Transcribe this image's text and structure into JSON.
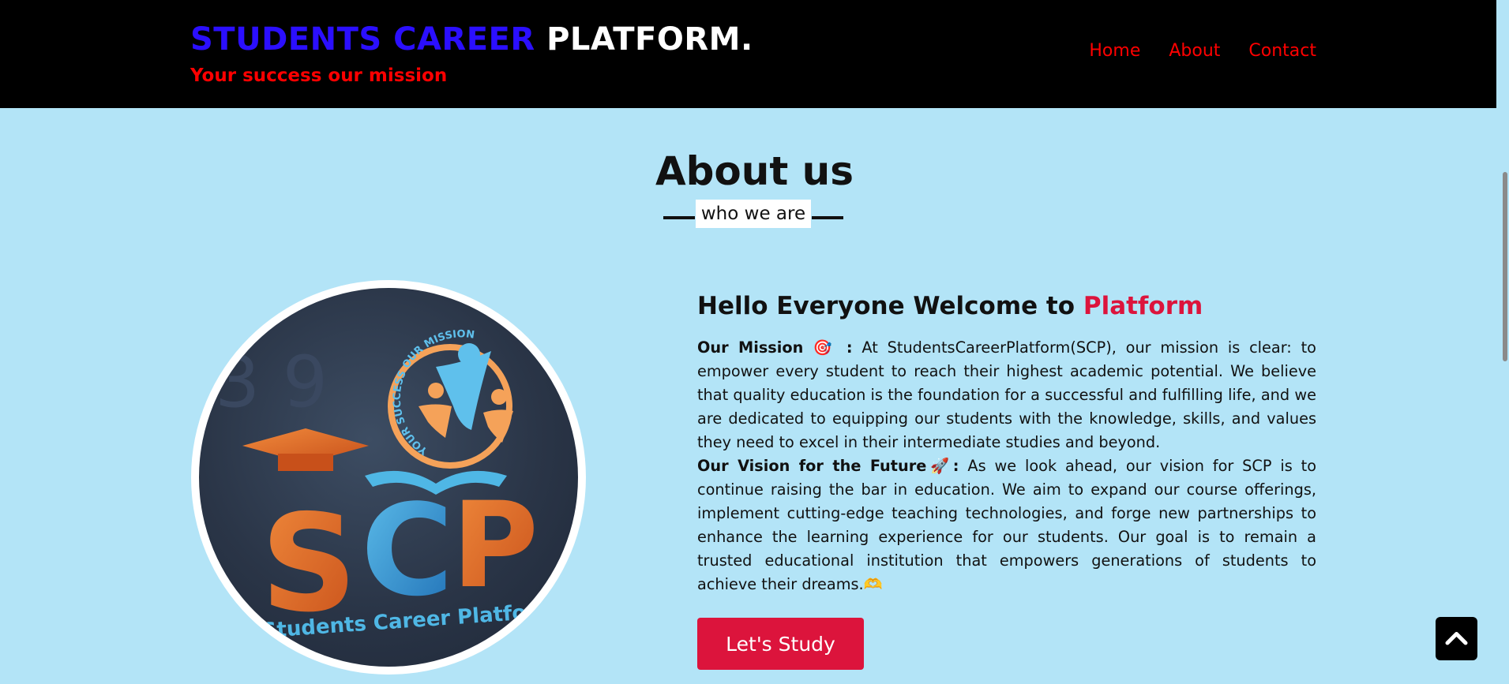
{
  "header": {
    "brand_part1": "STUDENTS CAREER",
    "brand_part2": "PLATFORM.",
    "tagline": "Your success our mission",
    "nav": [
      "Home",
      "About",
      "Contact"
    ]
  },
  "about": {
    "title": "About us",
    "subtitle": "who we are"
  },
  "logo": {
    "letters": "SCP",
    "arc_text": "YOUR SUCCESS OUR MISSION",
    "caption": "Students Career Platform"
  },
  "content": {
    "hello_prefix": "Hello Everyone Welcome to ",
    "hello_accent": "Platform",
    "mission_label": "Our Mission 🎯 :",
    "mission_text": " At StudentsCareerPlatform(SCP), our mission is clear: to empower every student to reach their highest academic potential. We believe that quality education is the foundation for a successful and fulfilling life, and we are dedicated to equipping our students with the knowledge, skills, and values they need to excel in their intermediate studies and beyond.",
    "vision_label": "Our Vision for the Future🚀:",
    "vision_text": " As we look ahead, our vision for SCP is to continue raising the bar in education. We aim to expand our course offerings, implement cutting-edge teaching technologies, and forge new partnerships to enhance the learning experience for our students. Our goal is to remain a trusted educational institution that empowers generations of students to achieve their dreams.🫶",
    "cta_label": "Let's Study"
  },
  "icons": {
    "scroll_top": "chevron-up-icon"
  },
  "colors": {
    "header_bg": "#000000",
    "brand_blue": "#2b0fff",
    "nav_red": "#ff0000",
    "page_bg": "#b3e4f7",
    "accent": "#dc143c"
  }
}
